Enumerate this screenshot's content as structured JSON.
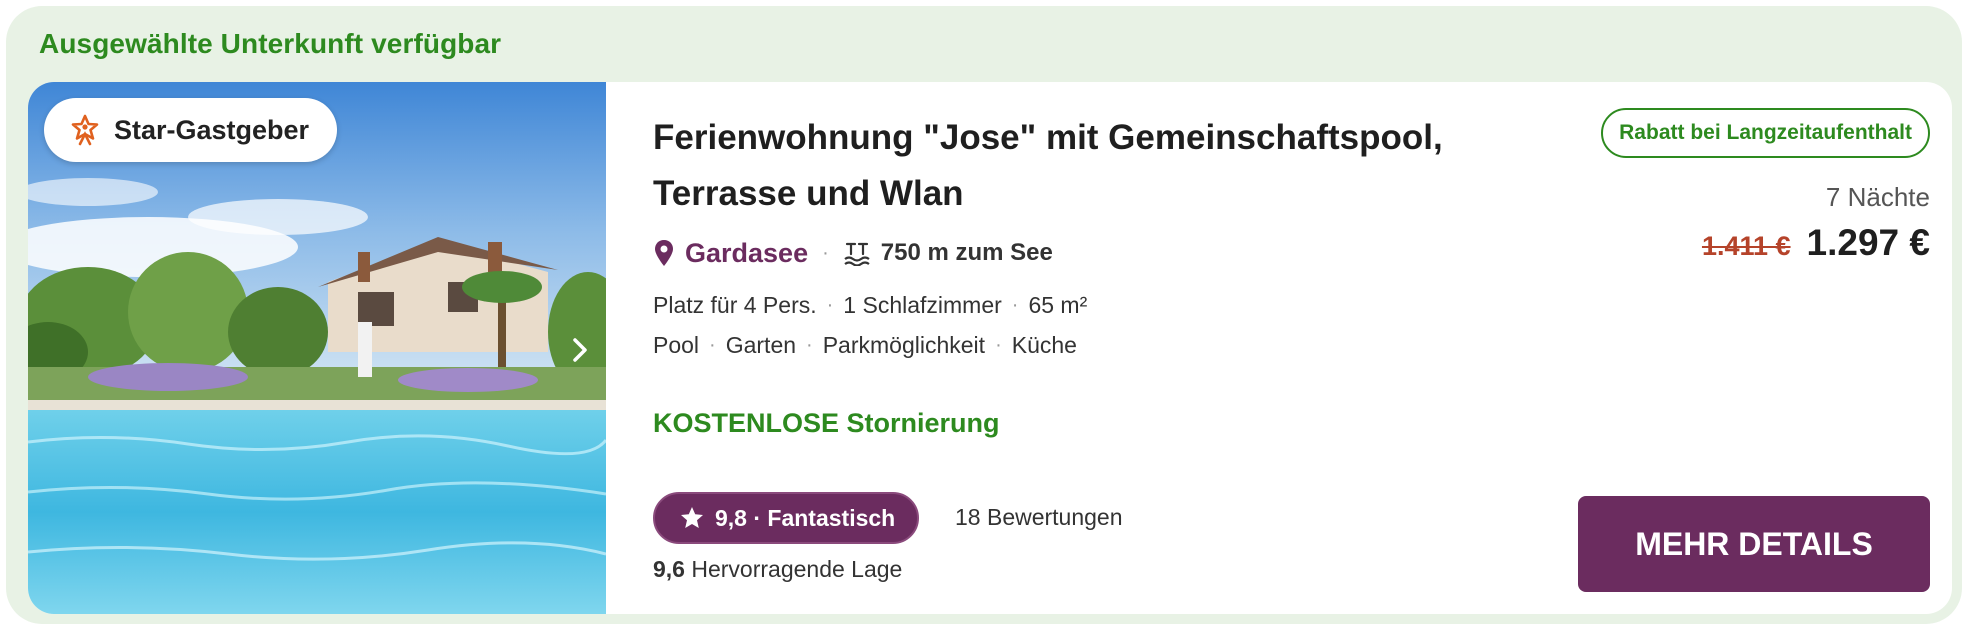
{
  "banner": {
    "text": "Ausgewählte Unterkunft verfügbar"
  },
  "listing": {
    "host_badge": {
      "label": "Star-Gastgeber",
      "icon": "star-person-icon"
    },
    "title_line1": "Ferienwohnung \"Jose\" mit Gemeinschaftspool,",
    "title_line2": "Terrasse und Wlan",
    "location": {
      "place": "Gardasee",
      "distance": "750 m zum See",
      "icons": [
        "map-pin-icon",
        "lake-distance-icon"
      ]
    },
    "facts": [
      "Platz für 4 Pers.",
      "1 Schlafzimmer",
      "65 m²"
    ],
    "amenities": [
      "Pool",
      "Garten",
      "Parkmöglichkeit",
      "Küche"
    ],
    "cancellation": "KOSTENLOSE Stornierung",
    "rating": {
      "label": "9,8 · Fantastisch",
      "reviews": "18 Bewertungen"
    },
    "location_score": {
      "value": "9,6",
      "label": "Hervorragende Lage"
    },
    "discount_badge": "Rabatt bei Langzeitaufenthalt",
    "nights": "7 Nächte",
    "price_old": "1.411 €",
    "price_new": "1.297 €",
    "details_button": "MEHR DETAILS"
  },
  "colors": {
    "accent_green": "#2d8a1f",
    "brand_purple": "#6b2c5f",
    "strike_red": "#b5432a",
    "banner_bg": "#e8f2e5"
  }
}
